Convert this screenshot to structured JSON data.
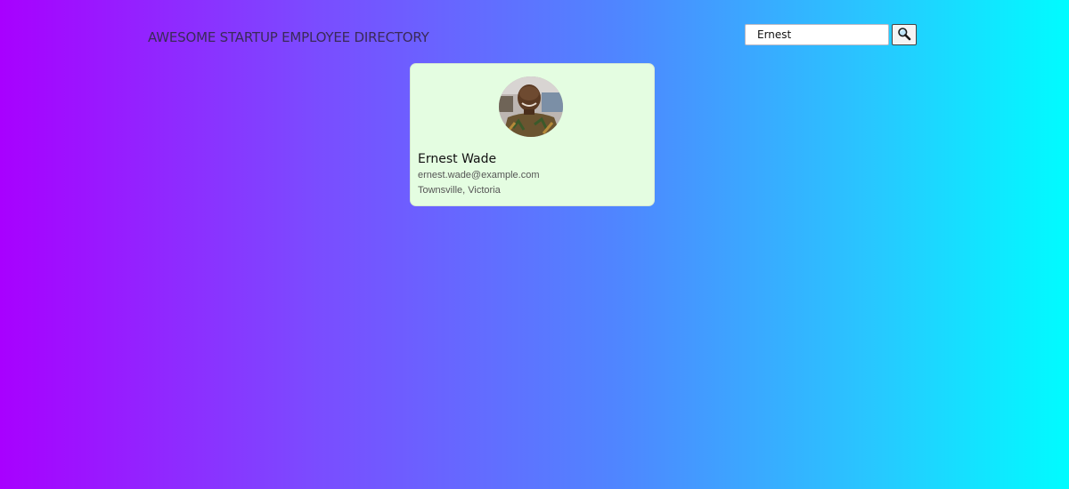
{
  "header": {
    "title": "AWESOME STARTUP EMPLOYEE DIRECTORY"
  },
  "search": {
    "value": "Ernest",
    "button_icon": "magnifier-icon"
  },
  "employees": [
    {
      "name": "Ernest Wade",
      "email": "ernest.wade@example.com",
      "location": "Townsville, Victoria",
      "avatar_icon": "employee-photo"
    }
  ],
  "colors": {
    "gradient_start": "#a800ff",
    "gradient_end": "#00fcff",
    "card_background": "#e4fde1",
    "title_color": "#3a2a58"
  }
}
